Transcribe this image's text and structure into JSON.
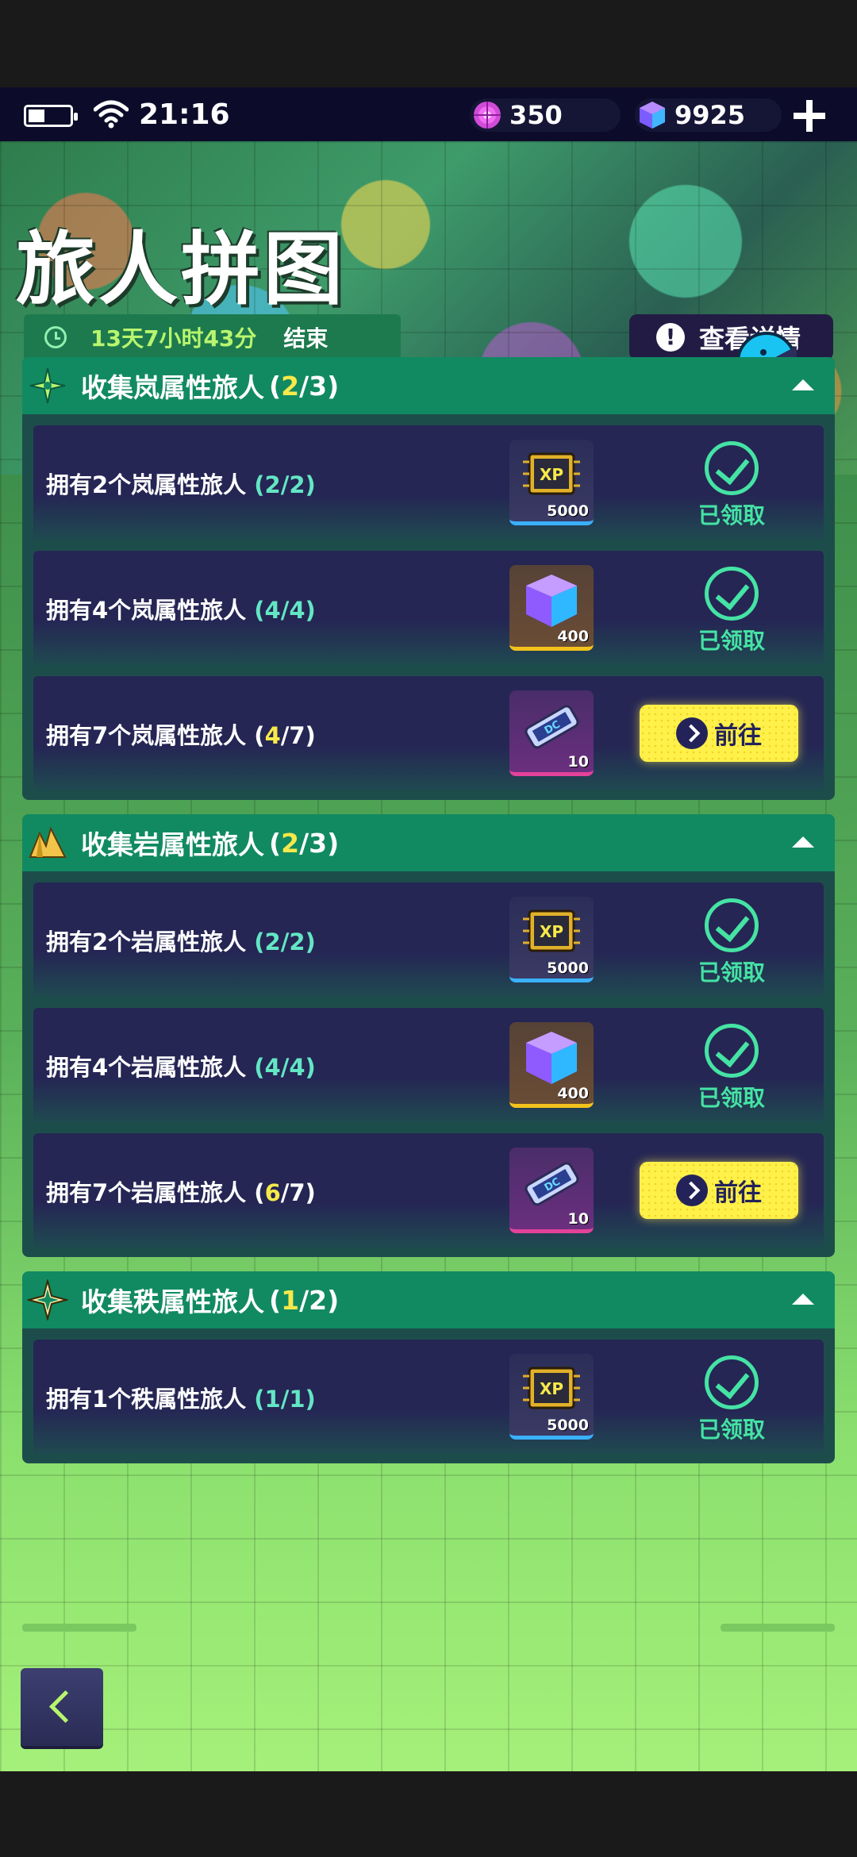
{
  "status_bar": {
    "time": "21:16",
    "currency_1": {
      "icon": "pink-orb-icon",
      "value": "350"
    },
    "currency_2": {
      "icon": "cube-icon",
      "value": "9925"
    }
  },
  "header": {
    "title": "旅人拼图",
    "timer": "13天7小时43分",
    "timer_suffix": "结束",
    "details_label": "查看详情"
  },
  "groups": [
    {
      "title": "收集岚属性旅人",
      "progress_current": "2",
      "progress_total": "/3)",
      "progress_open": "(",
      "tasks": [
        {
          "label": "拥有2个岚属性旅人",
          "progress": "(2/2)",
          "reward": "xp",
          "count": "5000",
          "status": "已领取"
        },
        {
          "label": "拥有4个岚属性旅人",
          "progress": "(4/4)",
          "reward": "cube",
          "count": "400",
          "status": "已领取"
        },
        {
          "label": "拥有7个岚属性旅人",
          "progress_open": "(",
          "progress_current": "4",
          "progress_total": "/7)",
          "reward": "ticket",
          "count": "10",
          "status": "前往"
        }
      ]
    },
    {
      "title": "收集岩属性旅人",
      "progress_current": "2",
      "progress_total": "/3)",
      "progress_open": "(",
      "tasks": [
        {
          "label": "拥有2个岩属性旅人",
          "progress": "(2/2)",
          "reward": "xp",
          "count": "5000",
          "status": "已领取"
        },
        {
          "label": "拥有4个岩属性旅人",
          "progress": "(4/4)",
          "reward": "cube",
          "count": "400",
          "status": "已领取"
        },
        {
          "label": "拥有7个岩属性旅人",
          "progress_open": "(",
          "progress_current": "6",
          "progress_total": "/7)",
          "reward": "ticket",
          "count": "10",
          "status": "前往"
        }
      ]
    },
    {
      "title": "收集秩属性旅人",
      "progress_current": "1",
      "progress_total": "/2)",
      "progress_open": "(",
      "tasks": [
        {
          "label": "拥有1个秩属性旅人",
          "progress": "(1/1)",
          "reward": "xp",
          "count": "5000",
          "status": "已领取"
        }
      ]
    }
  ],
  "colors": {
    "accent_green": "#45e3a4",
    "highlight_yellow": "#f7e94a",
    "header_green": "#118a62",
    "card_navy": "#252654"
  }
}
